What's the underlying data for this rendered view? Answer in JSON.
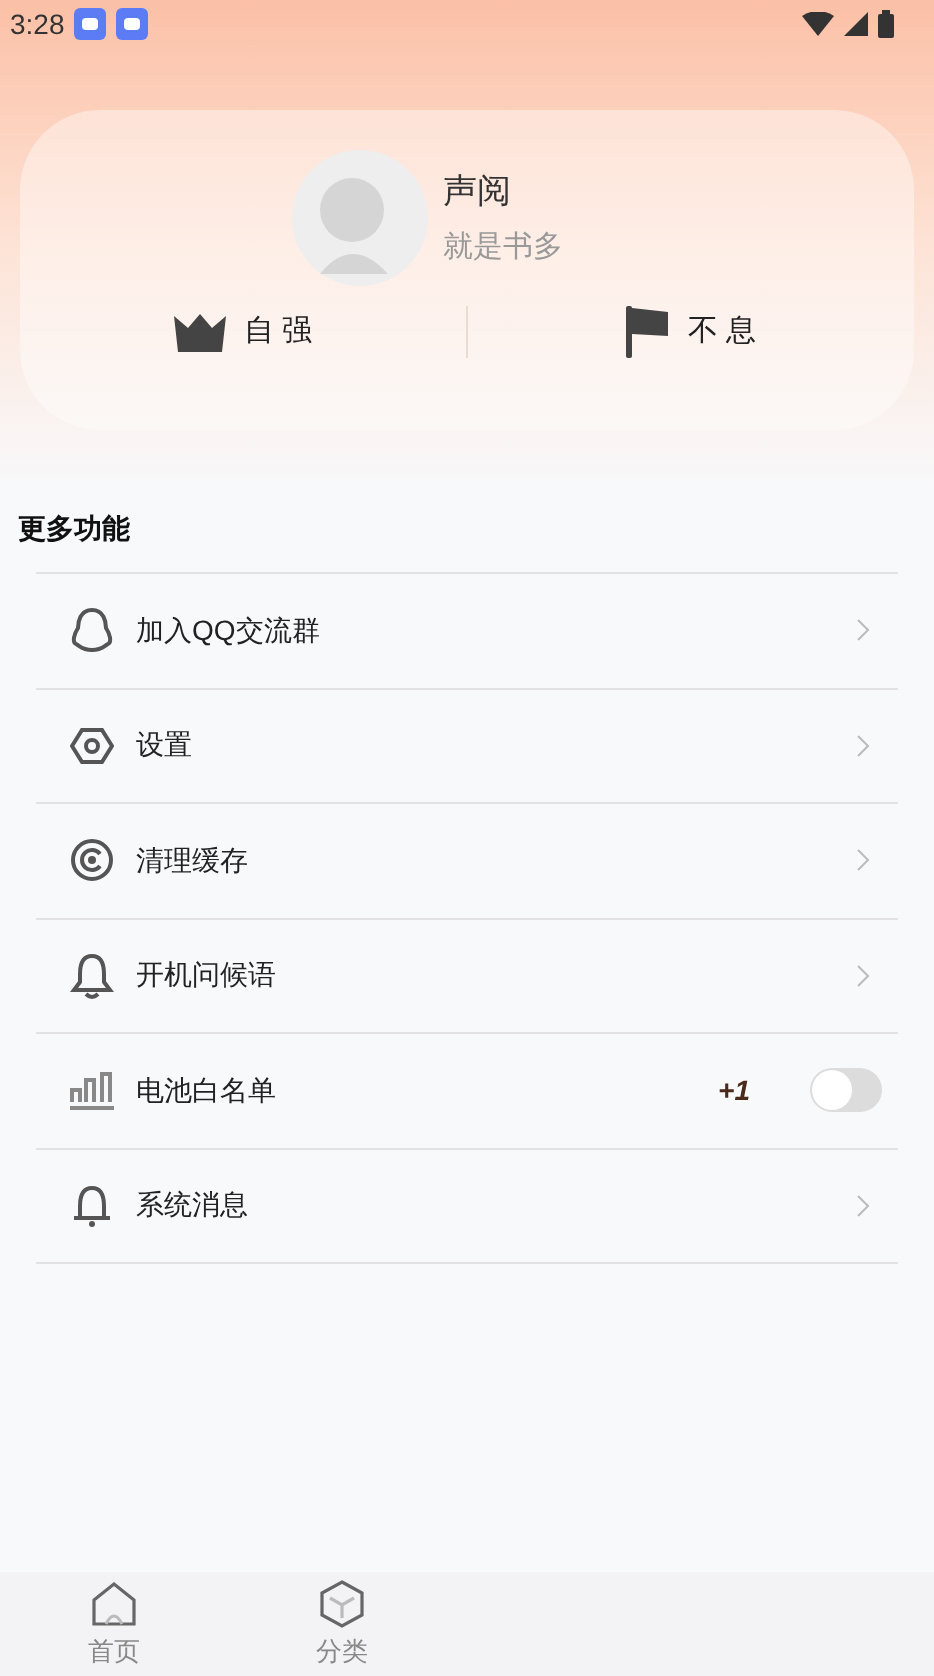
{
  "status_bar": {
    "time": "3:28"
  },
  "profile": {
    "name": "声阅",
    "subtitle": "就是书多"
  },
  "stats": [
    {
      "kind": "crown",
      "label": "自 强"
    },
    {
      "kind": "flag",
      "label": "不 息"
    }
  ],
  "section_title": "更多功能",
  "menu": [
    {
      "kind": "link",
      "label": "加入QQ交流群"
    },
    {
      "kind": "link",
      "label": "设置"
    },
    {
      "kind": "link",
      "label": "清理缓存"
    },
    {
      "kind": "link",
      "label": "开机问候语"
    },
    {
      "kind": "toggle",
      "label": "电池白名单",
      "badge": "+1",
      "on": false
    },
    {
      "kind": "link",
      "label": "系统消息"
    }
  ],
  "bottom_nav": [
    {
      "label": "首页"
    },
    {
      "label": "分类"
    }
  ]
}
